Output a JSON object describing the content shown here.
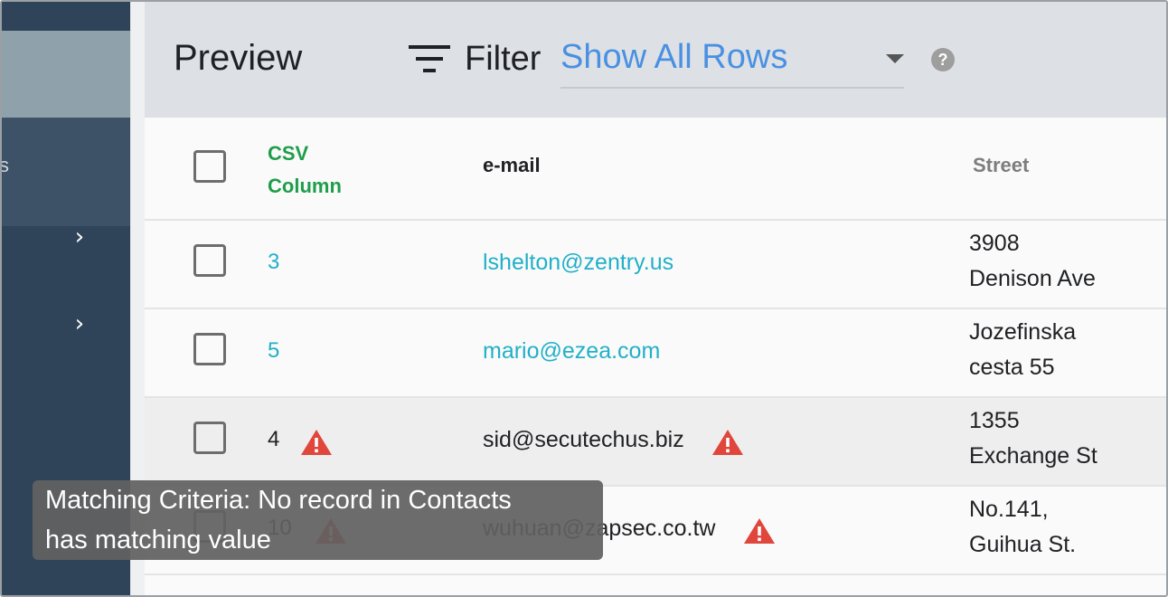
{
  "header": {
    "title": "Preview",
    "filter_label": "Filter",
    "filter_value": "Show All Rows"
  },
  "table": {
    "columns": {
      "csv": [
        "CSV",
        "Column"
      ],
      "email": "e-mail",
      "street": "Street"
    },
    "rows": [
      {
        "csv": "3",
        "email": "lshelton@zentry.us",
        "street": [
          "3908",
          "Denison Ave"
        ],
        "warning": false
      },
      {
        "csv": "5",
        "email": "mario@ezea.com",
        "street": [
          "Jozefinska",
          "cesta 55"
        ],
        "warning": false
      },
      {
        "csv": "4",
        "email": "sid@secutechus.biz",
        "street": [
          "1355",
          "Exchange St"
        ],
        "warning": true
      },
      {
        "csv": "10",
        "email": "wuhuan@zapsec.co.tw",
        "street": [
          "No.141,",
          "Guihua St."
        ],
        "warning": true
      }
    ]
  },
  "tooltip": {
    "lines": [
      "Matching Criteria: No record in Contacts",
      "has matching value"
    ]
  },
  "colors": {
    "sidebar": "#2f4459",
    "header_bg": "#dde1e5",
    "link": "#21b0c8",
    "csv_header": "#1e9e4a",
    "warning": "#e0463c",
    "filter_value": "#4a90e2"
  },
  "icons": [
    "filter-icon",
    "help-icon",
    "chevron-right-icon",
    "warning-icon"
  ]
}
